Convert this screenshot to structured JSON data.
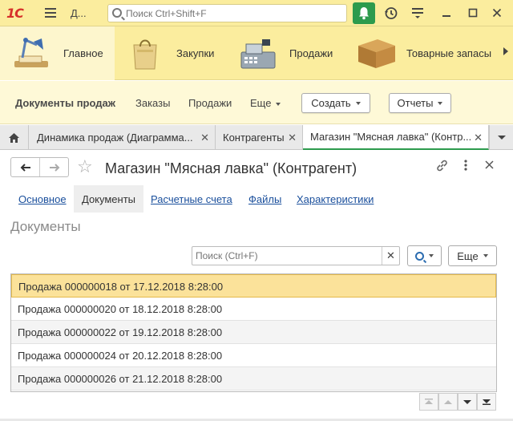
{
  "app": {
    "logo": "1С",
    "title": "Д...",
    "search_placeholder": "Поиск Ctrl+Shift+F"
  },
  "sections": [
    {
      "label": "Главное",
      "icon": "desk-lamp-icon",
      "active": true
    },
    {
      "label": "Закупки",
      "icon": "shopping-bag-icon",
      "active": false
    },
    {
      "label": "Продажи",
      "icon": "cash-register-icon",
      "active": false
    },
    {
      "label": "Товарные запасы",
      "icon": "box-icon",
      "active": false
    }
  ],
  "commands": {
    "current": "Документы продаж",
    "orders": "Заказы",
    "sales": "Продажи",
    "more": "Еще",
    "create": "Создать",
    "reports": "Отчеты"
  },
  "tabs": [
    {
      "label": "Динамика продаж (Диаграмма...",
      "active": false
    },
    {
      "label": "Контрагенты",
      "active": false
    },
    {
      "label": "Магазин \"Мясная лавка\" (Контр...",
      "active": true
    }
  ],
  "form": {
    "title": "Магазин \"Мясная лавка\" (Контрагент)",
    "tabs": [
      "Основное",
      "Документы",
      "Расчетные счета",
      "Файлы",
      "Характеристики"
    ],
    "active_tab": "Документы",
    "section_title": "Документы",
    "search_placeholder": "Поиск (Ctrl+F)",
    "more_label": "Еще"
  },
  "documents": [
    {
      "text": "Продажа 000000018 от 17.12.2018 8:28:00",
      "selected": true
    },
    {
      "text": "Продажа 000000020 от 18.12.2018 8:28:00",
      "selected": false
    },
    {
      "text": "Продажа 000000022 от 19.12.2018 8:28:00",
      "selected": false
    },
    {
      "text": "Продажа 000000024 от 20.12.2018 8:28:00",
      "selected": false
    },
    {
      "text": "Продажа 000000026 от 21.12.2018 8:28:00",
      "selected": false
    }
  ],
  "colors": {
    "panel_yellow": "#fbed9e",
    "selected_row": "#fbe29a",
    "active_green": "#2d9b4d",
    "link_blue": "#1a4f9c"
  }
}
